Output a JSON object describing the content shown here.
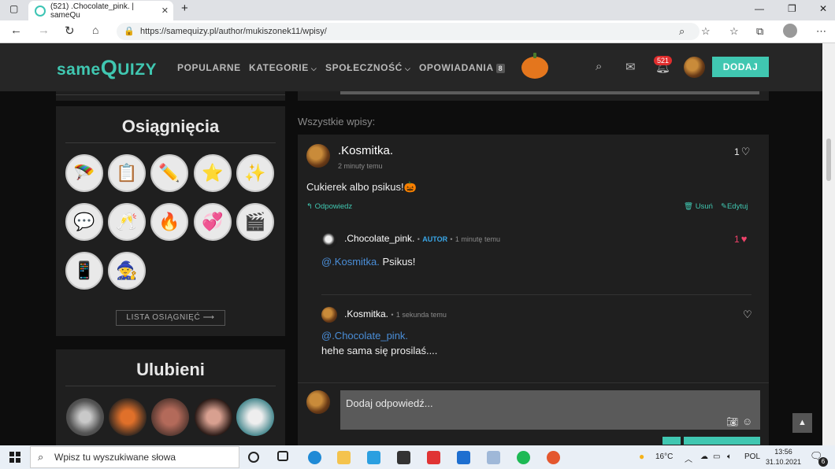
{
  "browser": {
    "tab_title": "(521) .Chocolate_pink. | sameQu",
    "url": "https://samequizy.pl/author/mukiszonek11/wpisy/"
  },
  "site": {
    "logo_same": "same",
    "logo_q": "Q",
    "logo_uizy": "UIZY",
    "menu": [
      "POPULARNE",
      "KATEGORIE",
      "SPOŁECZNOŚĆ",
      "OPOWIADANIA"
    ],
    "opowiadania_badge": "8",
    "notifications_count": "521",
    "add_button": "DODAJ",
    "brand_color": "#40c7b1"
  },
  "sidebar": {
    "achievements_title": "Osiągnięcia",
    "achievements": [
      "parachute-icon",
      "clipboard-icon",
      "pencil-icon",
      "star-icon",
      "stars-icon",
      "chat-icon",
      "cheers-icon",
      "fire-icon",
      "hearts-icon",
      "director-chair-icon",
      "phone-icon",
      "witch-icon"
    ],
    "achievements_list_button": "LISTA OSIĄGNIĘĆ ⟶",
    "favourites_title": "Ulubieni"
  },
  "main": {
    "all_posts_label": "Wszystkie wpisy:",
    "post": {
      "author": ".Kosmitka.",
      "time": "2 minuty temu",
      "likes": "1",
      "text": "Cukierek albo psikus!🎃",
      "reply_action": "Odpowiedz",
      "delete_action": "Usuń",
      "edit_action": "Edytuj"
    },
    "replies": [
      {
        "author": ".Chocolate_pink.",
        "badge": "AUTOR",
        "time": "1 minutę temu",
        "likes": "1",
        "mention": "@.Kosmitka.",
        "text": "Psikus!"
      },
      {
        "author": ".Kosmitka.",
        "time": "1 sekunda temu",
        "mention": "@.Chocolate_pink.",
        "text": "hehe sama się prosilaś...."
      }
    ],
    "reply_placeholder": "Dodaj odpowiedź..."
  },
  "taskbar": {
    "search_placeholder": "Wpisz tu wyszukiwane słowa",
    "weather": "16°C",
    "language": "POL",
    "time": "13:56",
    "date": "31.10.2021",
    "notifications_count": "6"
  }
}
